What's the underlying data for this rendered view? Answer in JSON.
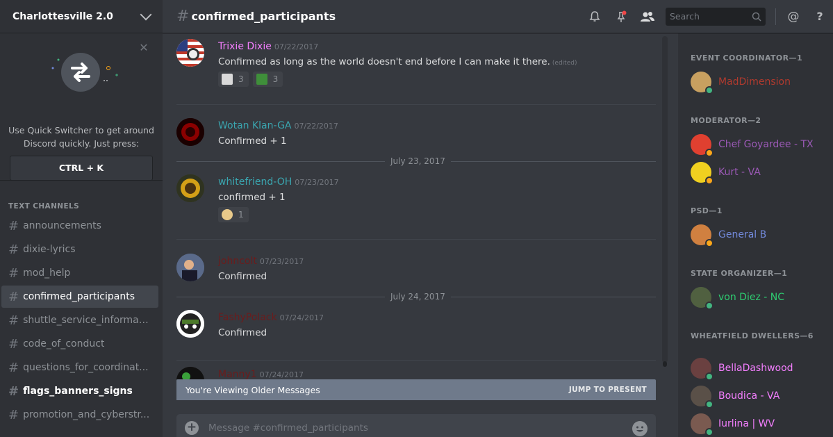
{
  "server": {
    "name": "Charlottesville 2.0"
  },
  "quick_switcher": {
    "text_line1": "Use Quick Switcher to get around",
    "text_line2": "Discord quickly. Just press:",
    "shortcut": "CTRL + K"
  },
  "channels": {
    "category": "TEXT CHANNELS",
    "items": [
      {
        "name": "announcements",
        "state": "normal"
      },
      {
        "name": "dixie-lyrics",
        "state": "normal"
      },
      {
        "name": "mod_help",
        "state": "normal"
      },
      {
        "name": "confirmed_participants",
        "state": "active"
      },
      {
        "name": "shuttle_service_informat...",
        "state": "normal"
      },
      {
        "name": "code_of_conduct",
        "state": "normal"
      },
      {
        "name": "questions_for_coordinat...",
        "state": "normal"
      },
      {
        "name": "flags_banners_signs",
        "state": "unread"
      },
      {
        "name": "promotion_and_cyberstr...",
        "state": "normal"
      }
    ]
  },
  "topbar": {
    "channel_name": "confirmed_participants",
    "search_placeholder": "Search"
  },
  "messages": [
    {
      "author": "Trixie Dixie",
      "color": "#f47fff",
      "ts": "07/22/2017",
      "text": "Confirmed as long as the world doesn't end before I can make it there.",
      "edited": "(edited)",
      "reactions": [
        {
          "count": "3",
          "color": "#d9d9d9"
        },
        {
          "count": "3",
          "color": "#3f8f3a"
        }
      ]
    },
    {
      "author": "Wotan Klan-GA",
      "color": "#3aa6b0",
      "ts": "07/22/2017",
      "text": "Confirmed + 1"
    },
    {
      "author": "whitefriend-OH",
      "color": "#3aa6b0",
      "ts": "07/23/2017",
      "text": "confirmed + 1",
      "reactions": [
        {
          "count": "1",
          "color": "#e8c98a"
        }
      ]
    },
    {
      "author": "johncolt",
      "color": "#6b1c1c",
      "ts": "07/23/2017",
      "text": "Confirmed"
    },
    {
      "author": "FashyPolack",
      "color": "#6b1c1c",
      "ts": "07/24/2017",
      "text": "Confirmed"
    },
    {
      "author": "Manny1",
      "color": "#6b1c1c",
      "ts": "07/24/2017",
      "text": ""
    }
  ],
  "date_dividers": [
    "July 23, 2017",
    "July 24, 2017"
  ],
  "older_bar": {
    "label": "You're Viewing Older Messages",
    "jump": "JUMP TO PRESENT"
  },
  "composer": {
    "placeholder": "Message #confirmed_participants"
  },
  "members": {
    "groups": [
      {
        "title": "EVENT COORDINATOR—1",
        "members": [
          {
            "name": "MadDimension",
            "color": "#b03a2e",
            "status": "#43b581"
          }
        ]
      },
      {
        "title": "MODERATOR—2",
        "members": [
          {
            "name": "Chef Goyardee - TX",
            "color": "#9b59b6",
            "status": "#faa61a"
          },
          {
            "name": "Kurt - VA",
            "color": "#9b59b6",
            "status": "#faa61a"
          }
        ]
      },
      {
        "title": "PSD—1",
        "members": [
          {
            "name": "General B",
            "color": "#7289da",
            "status": "#faa61a"
          }
        ]
      },
      {
        "title": "STATE ORGANIZER—1",
        "members": [
          {
            "name": "von Diez - NC",
            "color": "#2ecc71",
            "status": "#43b581"
          }
        ]
      },
      {
        "title": "WHEATFIELD DWELLERS—6",
        "members": [
          {
            "name": "BellaDashwood",
            "color": "#f47fff",
            "status": "#43b581"
          },
          {
            "name": "Boudica - VA",
            "color": "#f47fff",
            "status": "#43b581"
          },
          {
            "name": "Iurlina | WV",
            "color": "#f47fff",
            "status": "#43b581"
          }
        ]
      }
    ]
  }
}
